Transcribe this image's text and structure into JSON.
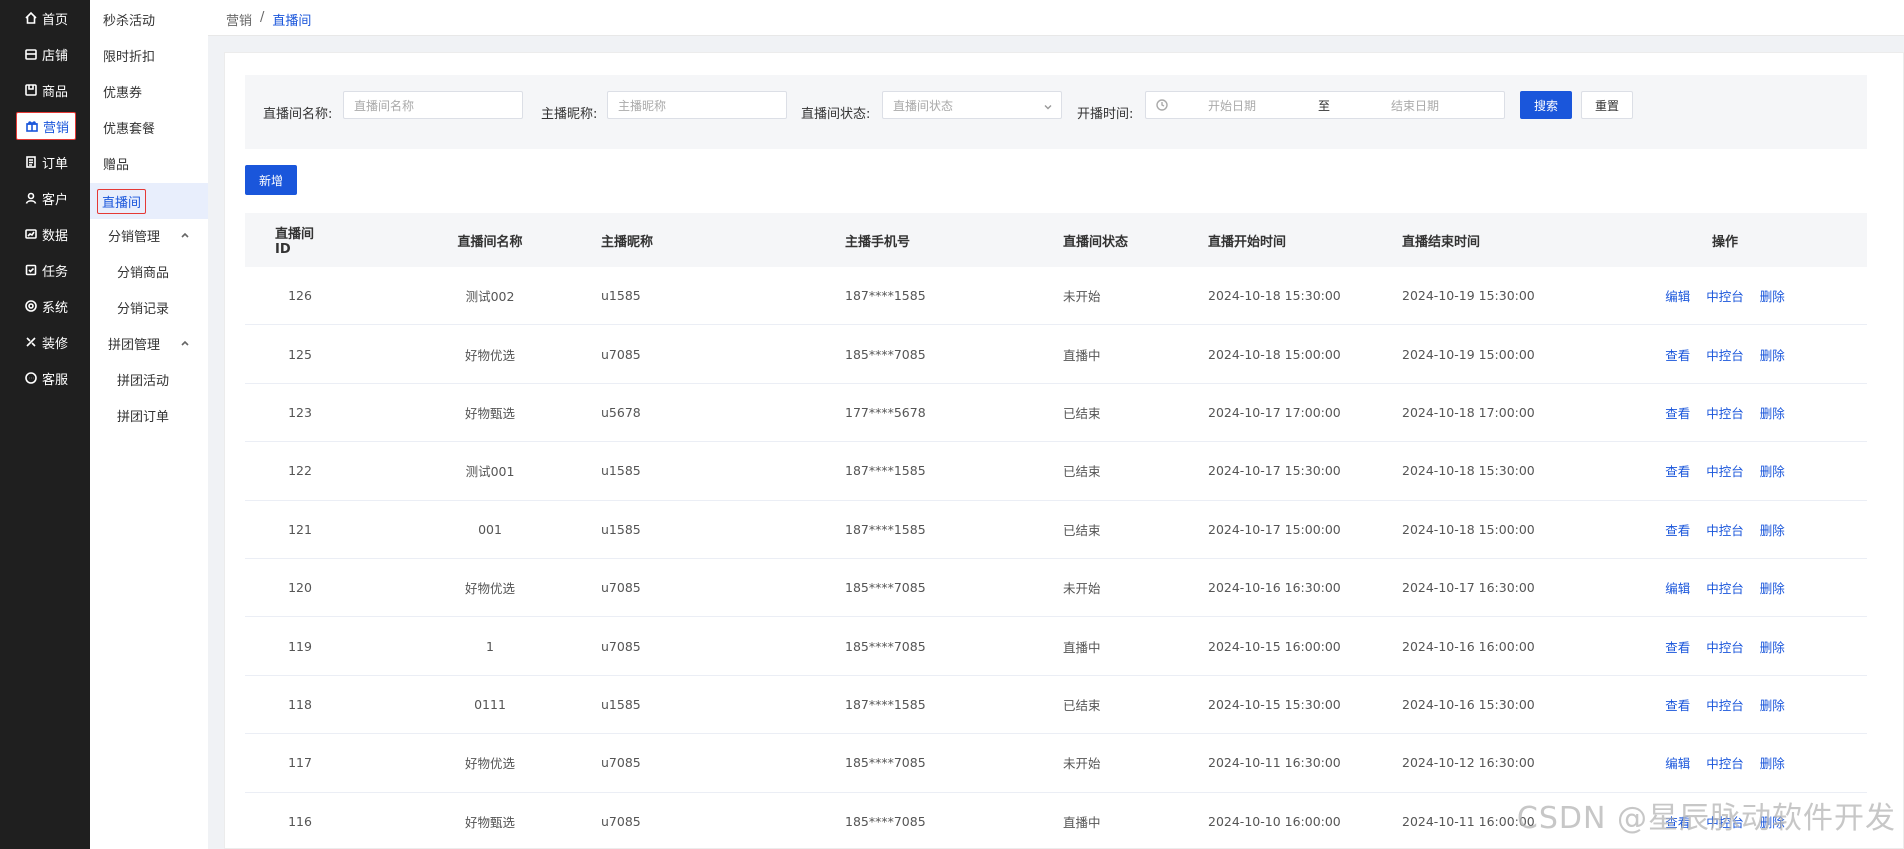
{
  "primary_nav": [
    {
      "label": "首页",
      "icon": "home-icon"
    },
    {
      "label": "店铺",
      "icon": "store-icon"
    },
    {
      "label": "商品",
      "icon": "goods-icon"
    },
    {
      "label": "营销",
      "icon": "gift-icon",
      "active": true
    },
    {
      "label": "订单",
      "icon": "order-icon"
    },
    {
      "label": "客户",
      "icon": "user-icon"
    },
    {
      "label": "数据",
      "icon": "data-icon"
    },
    {
      "label": "任务",
      "icon": "task-icon"
    },
    {
      "label": "系统",
      "icon": "gear-icon"
    },
    {
      "label": "装修",
      "icon": "decorate-icon"
    },
    {
      "label": "客服",
      "icon": "chat-icon"
    }
  ],
  "secondary_nav": {
    "items": [
      "秒杀活动",
      "限时折扣",
      "优惠券",
      "优惠套餐",
      "赠品",
      "直播间"
    ],
    "selected": "直播间",
    "group1": {
      "label": "分销管理",
      "children": [
        "分销商品",
        "分销记录"
      ]
    },
    "group2": {
      "label": "拼团管理",
      "children": [
        "拼团活动",
        "拼团订单"
      ]
    }
  },
  "breadcrumb": {
    "parent": "营销",
    "separator": "/",
    "current": "直播间"
  },
  "filters": {
    "room_name_label": "直播间名称:",
    "room_name_placeholder": "直播间名称",
    "host_label": "主播昵称:",
    "host_placeholder": "主播昵称",
    "status_label": "直播间状态:",
    "status_placeholder": "直播间状态",
    "time_label": "开播时间:",
    "start_placeholder": "开始日期",
    "range_sep": "至",
    "end_placeholder": "结束日期",
    "search_label": "搜索",
    "reset_label": "重置"
  },
  "add_label": "新增",
  "table": {
    "columns": [
      "直播间ID",
      "直播间名称",
      "主播昵称",
      "主播手机号",
      "直播间状态",
      "直播开始时间",
      "直播结束时间",
      "操作"
    ],
    "rows": [
      {
        "id": "126",
        "name": "测试002",
        "host": "u1585",
        "phone": "187****1585",
        "status": "未开始",
        "start": "2024-10-18 15:30:00",
        "end": "2024-10-19 15:30:00",
        "op1": "编辑",
        "op2": "中控台",
        "op3": "删除"
      },
      {
        "id": "125",
        "name": "好物优选",
        "host": "u7085",
        "phone": "185****7085",
        "status": "直播中",
        "start": "2024-10-18 15:00:00",
        "end": "2024-10-19 15:00:00",
        "op1": "查看",
        "op2": "中控台",
        "op3": "删除"
      },
      {
        "id": "123",
        "name": "好物甄选",
        "host": "u5678",
        "phone": "177****5678",
        "status": "已结束",
        "start": "2024-10-17 17:00:00",
        "end": "2024-10-18 17:00:00",
        "op1": "查看",
        "op2": "中控台",
        "op3": "删除"
      },
      {
        "id": "122",
        "name": "测试001",
        "host": "u1585",
        "phone": "187****1585",
        "status": "已结束",
        "start": "2024-10-17 15:30:00",
        "end": "2024-10-18 15:30:00",
        "op1": "查看",
        "op2": "中控台",
        "op3": "删除"
      },
      {
        "id": "121",
        "name": "001",
        "host": "u1585",
        "phone": "187****1585",
        "status": "已结束",
        "start": "2024-10-17 15:00:00",
        "end": "2024-10-18 15:00:00",
        "op1": "查看",
        "op2": "中控台",
        "op3": "删除"
      },
      {
        "id": "120",
        "name": "好物优选",
        "host": "u7085",
        "phone": "185****7085",
        "status": "未开始",
        "start": "2024-10-16 16:30:00",
        "end": "2024-10-17 16:30:00",
        "op1": "编辑",
        "op2": "中控台",
        "op3": "删除"
      },
      {
        "id": "119",
        "name": "1",
        "host": "u7085",
        "phone": "185****7085",
        "status": "直播中",
        "start": "2024-10-15 16:00:00",
        "end": "2024-10-16 16:00:00",
        "op1": "查看",
        "op2": "中控台",
        "op3": "删除"
      },
      {
        "id": "118",
        "name": "0111",
        "host": "u1585",
        "phone": "187****1585",
        "status": "已结束",
        "start": "2024-10-15 15:30:00",
        "end": "2024-10-16 15:30:00",
        "op1": "查看",
        "op2": "中控台",
        "op3": "删除"
      },
      {
        "id": "117",
        "name": "好物优选",
        "host": "u7085",
        "phone": "185****7085",
        "status": "未开始",
        "start": "2024-10-11 16:30:00",
        "end": "2024-10-12 16:30:00",
        "op1": "编辑",
        "op2": "中控台",
        "op3": "删除"
      },
      {
        "id": "116",
        "name": "好物甄选",
        "host": "u7085",
        "phone": "185****7085",
        "status": "直播中",
        "start": "2024-10-10 16:00:00",
        "end": "2024-10-11 16:00:00",
        "op1": "查看",
        "op2": "中控台",
        "op3": "删除"
      }
    ]
  },
  "watermark": "CSDN @星辰脉动软件开发",
  "colors": {
    "primary": "#1a56db",
    "sidebar_bg": "#1f1f1f",
    "highlight_border": "#e53935"
  }
}
